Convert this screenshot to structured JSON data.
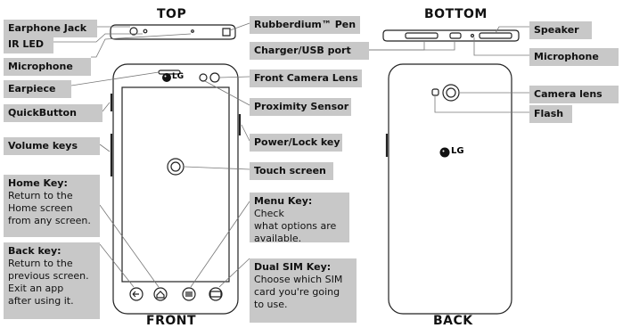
{
  "sections": {
    "top": "TOP",
    "bottom": "BOTTOM",
    "front": "FRONT",
    "back": "BACK"
  },
  "labels": {
    "earphone_jack": "Earphone Jack",
    "ir_led": "IR LED",
    "microphone_top": "Microphone",
    "earpiece": "Earpiece",
    "quickbutton": "QuickButton",
    "volume_keys": "Volume keys",
    "rubberdium_pen": "Rubberdium™ Pen",
    "charger_usb": "Charger/USB port",
    "front_camera": "Front Camera Lens",
    "proximity_sensor": "Proximity Sensor",
    "power_lock": "Power/Lock key",
    "touch_screen": "Touch screen",
    "speaker": "Speaker",
    "microphone_bottom": "Microphone",
    "camera_lens": "Camera lens",
    "flash": "Flash"
  },
  "callouts": {
    "home_key": {
      "title": "Home Key:",
      "desc": "Return to the\nHome screen\nfrom any screen."
    },
    "back_key": {
      "title": "Back key:",
      "desc": "Return to the\nprevious screen.\nExit an app\nafter using it."
    },
    "menu_key": {
      "title": "Menu Key:",
      "desc": "Check\nwhat options are\navailable.",
      "inline": true
    },
    "dual_sim_key": {
      "title": "Dual SIM Key:",
      "desc": "Choose which SIM\ncard you're going\nto use."
    }
  },
  "logo": "LG"
}
